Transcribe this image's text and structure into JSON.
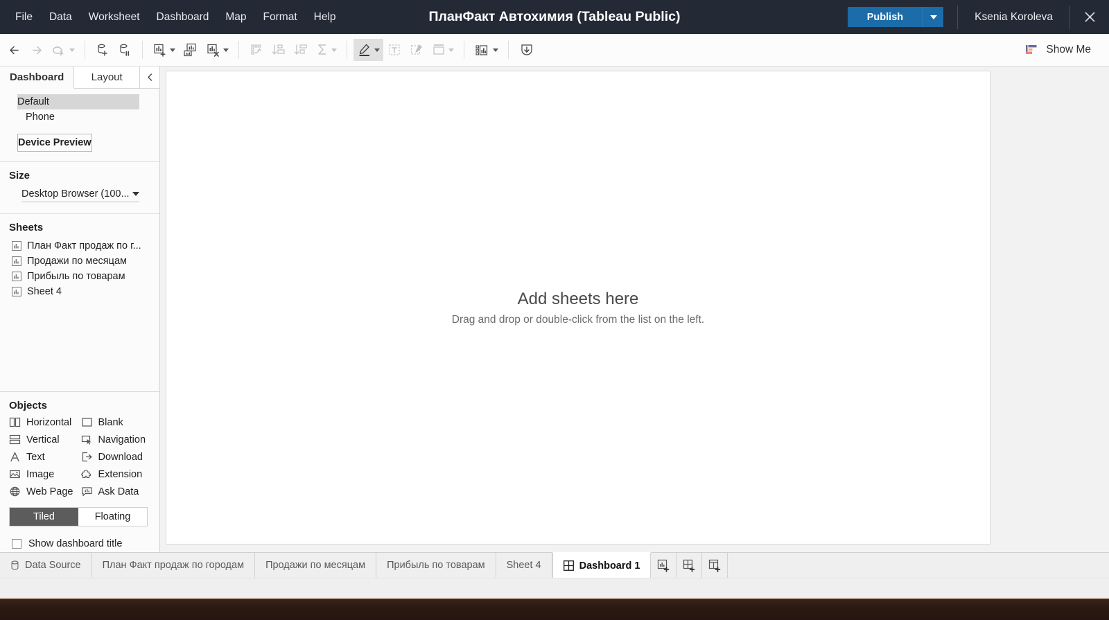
{
  "window": {
    "title": "ПланФакт Автохимия (Tableau Public)",
    "close_icon": "close-icon"
  },
  "menubar": {
    "items": [
      {
        "label": "File"
      },
      {
        "label": "Data"
      },
      {
        "label": "Worksheet"
      },
      {
        "label": "Dashboard"
      },
      {
        "label": "Map"
      },
      {
        "label": "Format"
      },
      {
        "label": "Help"
      }
    ]
  },
  "account": {
    "publish_label": "Publish",
    "publish_caret_icon": "chevron-down-icon",
    "username": "Ksenia Koroleva"
  },
  "toolbar": {
    "buttons": [
      {
        "name": "back-icon",
        "state": "enabled"
      },
      {
        "name": "forward-icon",
        "state": "disabled"
      },
      {
        "name": "undo-redo-icon",
        "state": "disabled"
      },
      {
        "name": "new-data-source-icon",
        "state": "enabled"
      },
      {
        "name": "pause-data-source-icon",
        "state": "enabled"
      },
      {
        "name": "new-worksheet-icon",
        "state": "enabled"
      },
      {
        "name": "duplicate-sheet-icon",
        "state": "enabled"
      },
      {
        "name": "clear-sheet-icon",
        "state": "enabled"
      },
      {
        "name": "swap-rows-columns-icon",
        "state": "disabled"
      },
      {
        "name": "sort-ascending-icon",
        "state": "disabled"
      },
      {
        "name": "sort-descending-icon",
        "state": "disabled"
      },
      {
        "name": "totals-icon",
        "state": "disabled"
      },
      {
        "name": "highlight-icon",
        "state": "active"
      },
      {
        "name": "text-label-icon",
        "state": "disabled"
      },
      {
        "name": "annotate-icon",
        "state": "disabled"
      },
      {
        "name": "fit-icon",
        "state": "disabled"
      },
      {
        "name": "show-hide-cards-icon",
        "state": "enabled"
      },
      {
        "name": "present-mode-icon",
        "state": "enabled"
      }
    ],
    "show_me_label": "Show Me",
    "show_me_icon": "show-me-icon"
  },
  "left_panel": {
    "tabs": [
      {
        "label": "Dashboard",
        "selected": true
      },
      {
        "label": "Layout",
        "selected": false
      }
    ],
    "collapse_icon": "chevron-left-icon",
    "devices": [
      {
        "label": "Default",
        "selected": true
      },
      {
        "label": "Phone",
        "selected": false
      }
    ],
    "device_preview_label": "Device Preview",
    "size": {
      "title": "Size",
      "value": "Desktop Browser (100...",
      "caret_icon": "chevron-down-icon"
    },
    "sheets": {
      "title": "Sheets",
      "items": [
        {
          "label": "План Факт продаж по г...",
          "icon": "worksheet-icon"
        },
        {
          "label": "Продажи по месяцам",
          "icon": "worksheet-icon"
        },
        {
          "label": "Прибыль по товарам",
          "icon": "worksheet-icon"
        },
        {
          "label": "Sheet 4",
          "icon": "worksheet-icon"
        }
      ]
    },
    "objects": {
      "title": "Objects",
      "items": [
        {
          "label": "Horizontal",
          "icon": "horizontal-container-icon"
        },
        {
          "label": "Blank",
          "icon": "blank-object-icon"
        },
        {
          "label": "Vertical",
          "icon": "vertical-container-icon"
        },
        {
          "label": "Navigation",
          "icon": "navigation-icon"
        },
        {
          "label": "Text",
          "icon": "text-object-icon"
        },
        {
          "label": "Download",
          "icon": "download-icon"
        },
        {
          "label": "Image",
          "icon": "image-icon"
        },
        {
          "label": "Extension",
          "icon": "extension-icon"
        },
        {
          "label": "Web Page",
          "icon": "globe-icon"
        },
        {
          "label": "Ask Data",
          "icon": "ask-data-icon"
        }
      ]
    },
    "layout_toggle": [
      {
        "label": "Tiled",
        "active": true
      },
      {
        "label": "Floating",
        "active": false
      }
    ],
    "show_title": {
      "label": "Show dashboard title",
      "checked": false
    }
  },
  "canvas": {
    "headline": "Add sheets here",
    "subtext": "Drag and drop or double-click from the list on the left."
  },
  "sheet_tabs": {
    "items": [
      {
        "label": "Data Source",
        "icon": "data-source-icon",
        "current": false
      },
      {
        "label": "План Факт продаж по городам",
        "icon": "",
        "current": false
      },
      {
        "label": "Продажи по месяцам",
        "icon": "",
        "current": false
      },
      {
        "label": "Прибыль по товарам",
        "icon": "",
        "current": false
      },
      {
        "label": "Sheet 4",
        "icon": "",
        "current": false
      },
      {
        "label": "Dashboard 1",
        "icon": "dashboard-icon",
        "current": true
      }
    ],
    "actions": [
      {
        "name": "new-worksheet-tab-icon"
      },
      {
        "name": "new-dashboard-tab-icon"
      },
      {
        "name": "new-story-tab-icon"
      }
    ]
  },
  "colors": {
    "titlebar_bg": "#242936",
    "publish_blue": "#1b6ca8",
    "canvas_bg": "#f2f2f2",
    "desktop_brown": "#2e1c14"
  }
}
